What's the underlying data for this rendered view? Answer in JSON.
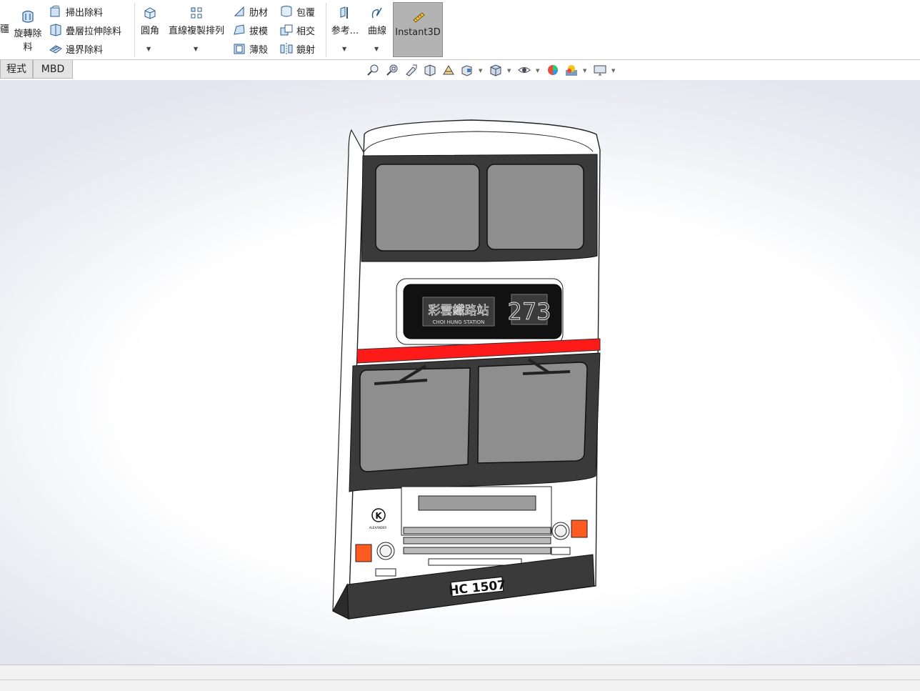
{
  "ribbon": {
    "edge_glyph": "疆",
    "revolve_cut": {
      "label_line1": "旋轉除",
      "label_line2": "料",
      "icon": "revolve-cut-icon"
    },
    "swept_cut": {
      "label": "掃出除料",
      "icon": "swept-cut-icon"
    },
    "lofted_cut": {
      "label": "疊層拉伸除料",
      "icon": "lofted-cut-icon"
    },
    "boundary_cut": {
      "label": "邊界除料",
      "icon": "boundary-cut-icon"
    },
    "fillet": {
      "label": "圓角",
      "icon": "fillet-icon"
    },
    "linear_pattern": {
      "label": "直線複製排列",
      "icon": "linear-pattern-icon"
    },
    "rib": {
      "label": "肋材",
      "icon": "rib-icon"
    },
    "draft": {
      "label": "拔模",
      "icon": "draft-icon"
    },
    "shell": {
      "label": "薄殼",
      "icon": "shell-icon"
    },
    "wrap": {
      "label": "包覆",
      "icon": "wrap-icon"
    },
    "intersect": {
      "label": "相交",
      "icon": "intersect-icon"
    },
    "mirror": {
      "label": "鏡射",
      "icon": "mirror-icon"
    },
    "reference": {
      "label": "参考...",
      "icon": "reference-geometry-icon"
    },
    "curves": {
      "label": "曲線",
      "icon": "curves-icon"
    },
    "instant3d": {
      "label": "Instant3D",
      "icon": "instant3d-icon",
      "active": true
    }
  },
  "tabs": [
    {
      "label": "程式"
    },
    {
      "label": "MBD"
    }
  ],
  "view_toolbar": [
    "zoom-to-fit-icon",
    "zoom-to-area-icon",
    "previous-view-icon",
    "section-view-icon",
    "dynamic-annotation-icon",
    "view-orientation-icon",
    "display-style-icon",
    "hide-show-items-icon",
    "edit-appearance-icon",
    "apply-scene-icon",
    "view-settings-icon"
  ],
  "model": {
    "route_number": "273",
    "plate": "HC 1507",
    "destination_cn": "彩雲鐵路站",
    "destination_en": "CHOI HUNG STATION",
    "logo_letter": "K",
    "logo_text": "ALEXANDER",
    "colors": {
      "body": "#ffffff",
      "band": "#ff1a1a",
      "glass": "#8e8e8e",
      "frame": "#3a3a3a",
      "bumper": "#3a3a3a",
      "lamp": "#ff5a1f"
    }
  }
}
